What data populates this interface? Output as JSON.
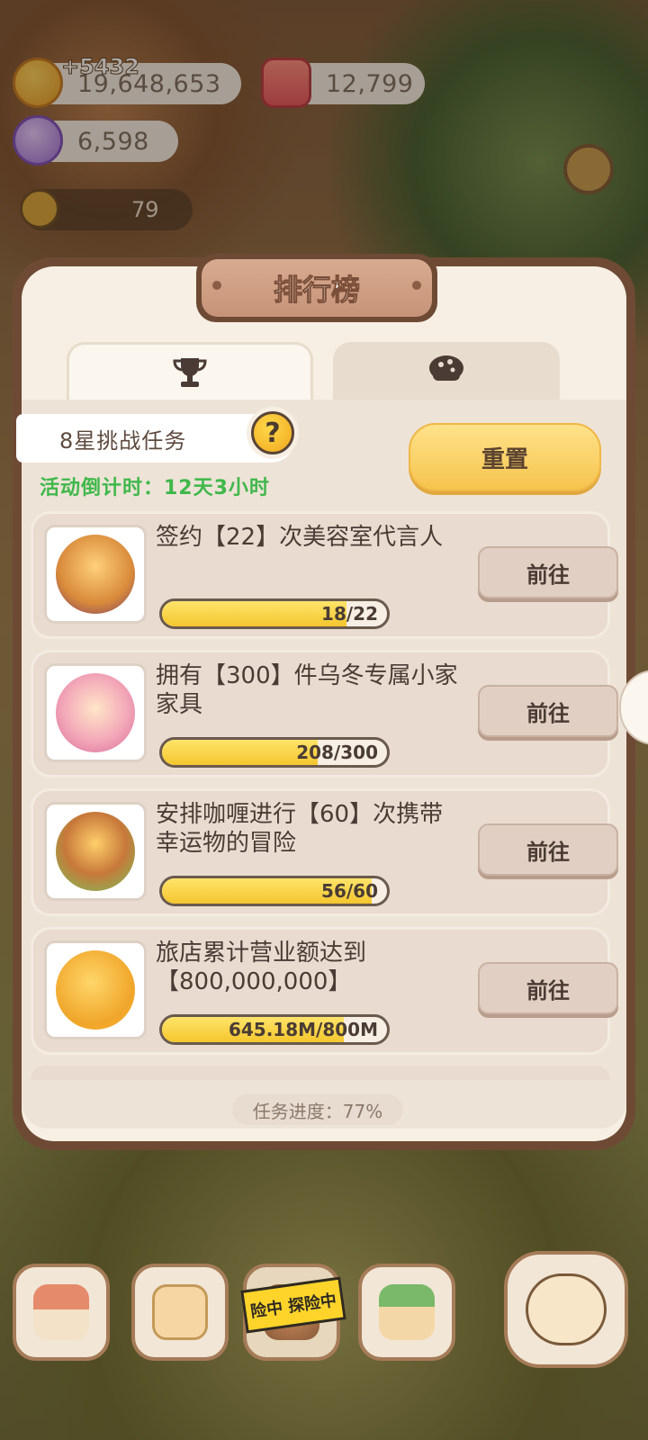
{
  "currencies": {
    "coins": "19,648,653",
    "coin_gain": "+5432",
    "candles": "12,799",
    "gems": "6,598",
    "level_count": "79"
  },
  "panel": {
    "title": "排行榜",
    "tabs": [
      {
        "icon": "trophy-icon"
      },
      {
        "icon": "cookie-icon"
      }
    ],
    "challenge_label": "8星挑战任务",
    "help_label": "?",
    "countdown": "活动倒计时：12天3小时",
    "reset_label": "重置",
    "overall_progress": "任务进度：77%"
  },
  "tasks": [
    {
      "text": "签约【22】次美容室代言人",
      "progress_text": "18/22",
      "progress": 0.818,
      "button": "前往",
      "icon": "cookie-model-stage-icon"
    },
    {
      "text": "拥有【300】件乌冬专属小家家具",
      "progress_text": "208/300",
      "progress": 0.693,
      "button": "前往",
      "icon": "furniture-scroll-icon"
    },
    {
      "text": "安排咖喱进行【60】次携带幸运物的冒险",
      "progress_text": "56/60",
      "progress": 0.933,
      "button": "前往",
      "icon": "adventure-flower-icon"
    },
    {
      "text": "旅店累计营业额达到【800,000,000】",
      "progress_text": "645.18M/800M",
      "progress": 0.806,
      "button": "前往",
      "icon": "gold-cookie-icon"
    }
  ],
  "bottom_nav": {
    "adventure_tape": "险中 探险中"
  },
  "colors": {
    "accent_yellow": "#f6c44e",
    "countdown_green": "#3fb84a",
    "frame_brown": "#6e4a34"
  }
}
